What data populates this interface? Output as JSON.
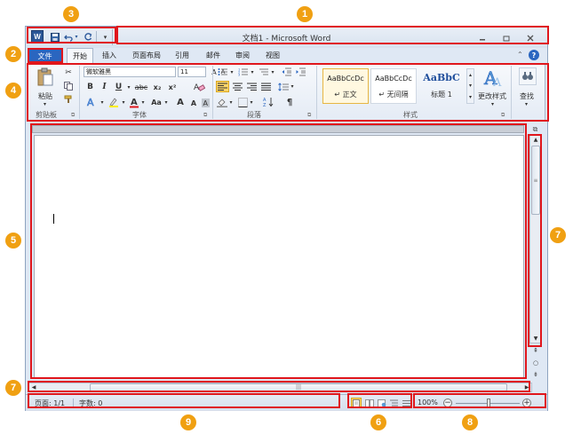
{
  "window": {
    "title": "文档1 - Microsoft Word",
    "app_icon_letter": "W",
    "controls": [
      "minimize-icon",
      "restore-icon",
      "close-icon"
    ]
  },
  "quick_access": {
    "icons": [
      "save-icon",
      "undo-icon",
      "redo-icon",
      "customize-qat-icon"
    ]
  },
  "tabs": {
    "file": "文件",
    "items": [
      "开始",
      "插入",
      "页面布局",
      "引用",
      "邮件",
      "审阅",
      "视图"
    ]
  },
  "ribbon": {
    "clipboard": {
      "label": "剪贴板",
      "paste": "粘贴"
    },
    "font": {
      "label": "字体",
      "font_name": "微软雅黑",
      "font_size": "11",
      "bold": "B",
      "italic": "I",
      "underline": "U",
      "strike": "abc",
      "subscript": "x₂",
      "superscript": "x²",
      "font_color": "A",
      "change_case": "Aa",
      "grow": "A",
      "shrink": "A"
    },
    "paragraph": {
      "label": "段落"
    },
    "styles": {
      "label": "样式",
      "cards": [
        {
          "sample": "AaBbCcDc",
          "name": "↵ 正文"
        },
        {
          "sample": "AaBbCcDc",
          "name": "↵ 无间隔"
        },
        {
          "sample": "AaBbC",
          "name": "标题 1"
        }
      ],
      "change_styles": "更改样式"
    },
    "editing": {
      "find": "查找"
    }
  },
  "status": {
    "page": "页面: 1/1",
    "word_count": "字数: 0",
    "zoom": "100%",
    "zoom_minus": "−",
    "zoom_plus": "+"
  },
  "markers": [
    "1",
    "2",
    "3",
    "4",
    "5",
    "6",
    "7",
    "7",
    "8",
    "9"
  ]
}
